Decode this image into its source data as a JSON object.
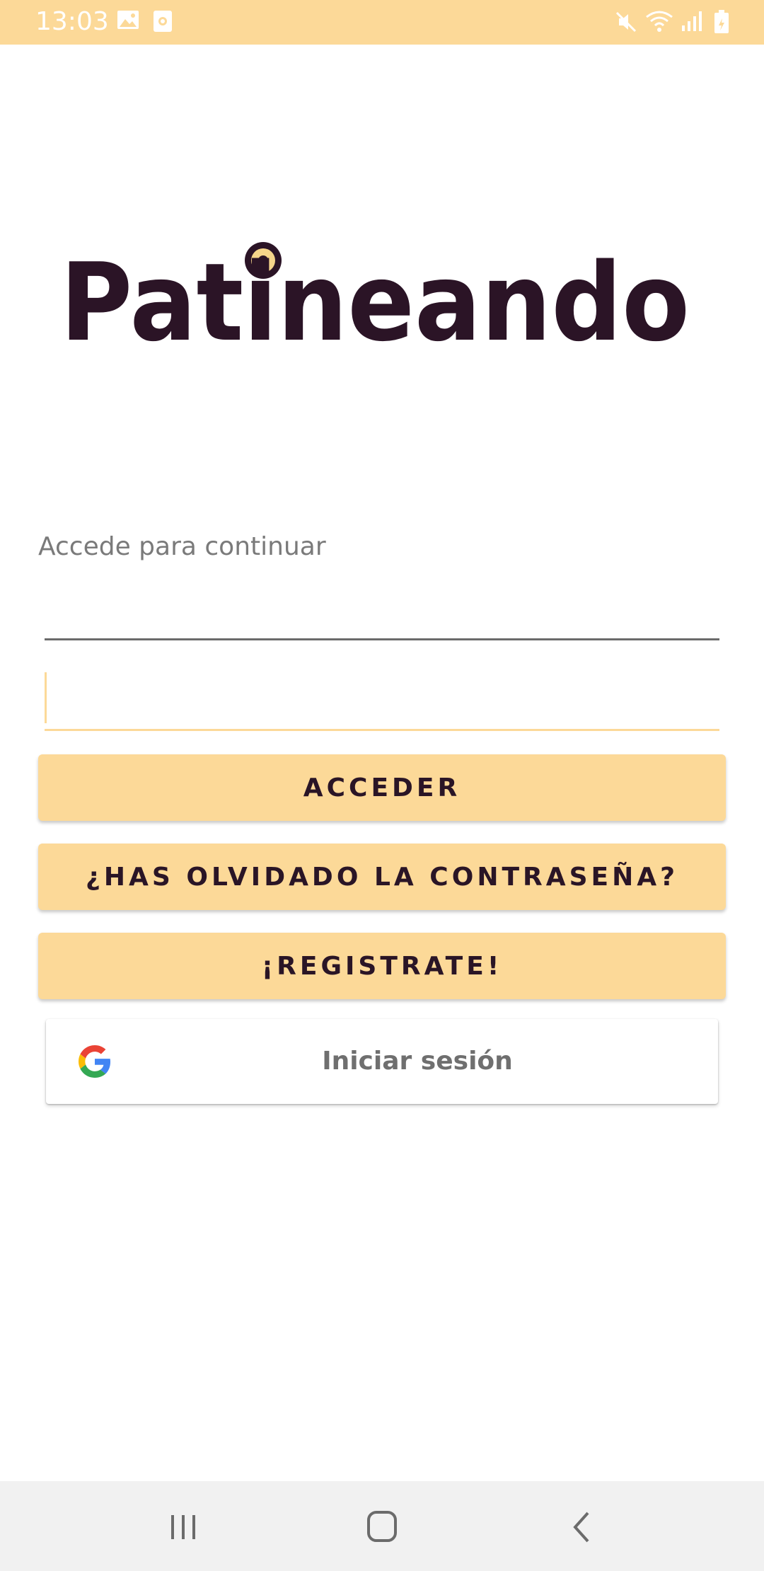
{
  "status_bar": {
    "time": "13:03",
    "left_icons": [
      "gallery-icon",
      "screenshot-icon"
    ],
    "right_icons": [
      "mute-icon",
      "wifi-icon",
      "signal-icon",
      "battery-icon"
    ],
    "color": "#fcd998"
  },
  "logo": {
    "text": "Patineando"
  },
  "login": {
    "subtitle": "Accede para continuar",
    "username": {
      "value": "",
      "placeholder": ""
    },
    "password": {
      "value": "",
      "placeholder": ""
    },
    "login_button": "ACCEDER",
    "forgot_button": "¿HAS OLVIDADO LA CONTRASEÑA?",
    "register_button": "¡REGISTRATE!",
    "google_button": "Iniciar sesión"
  },
  "nav_bar": {
    "buttons": [
      "recents-icon",
      "home-icon",
      "back-icon"
    ]
  },
  "colors": {
    "accent": "#fcd998",
    "button_text": "#2a1526",
    "logo": "#2b1426"
  }
}
